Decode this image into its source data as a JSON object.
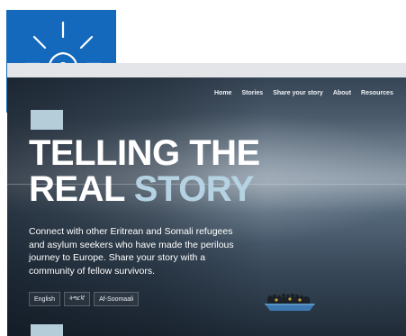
{
  "nav": {
    "items": [
      {
        "label": "Home"
      },
      {
        "label": "Stories"
      },
      {
        "label": "Share your story"
      },
      {
        "label": "About"
      },
      {
        "label": "Resources"
      }
    ]
  },
  "hero": {
    "title_line1": "TELLING THE",
    "title_line2_word1": "REAL",
    "title_line2_word2": "STORY",
    "description": "Connect with other Eritrean and Somali refugees and asylum seekers who have made the perilous journey to Europe. Share your story with a community of fellow survivors."
  },
  "languages": [
    "English",
    "ትግርኛ",
    "Af-Soomaali"
  ],
  "icons": {
    "tile": "lightbulb-icon",
    "scene": "boat-image"
  },
  "colors": {
    "icon_tile": "#1469bd",
    "accent": "#b4d2e2",
    "text": "#ffffff"
  }
}
